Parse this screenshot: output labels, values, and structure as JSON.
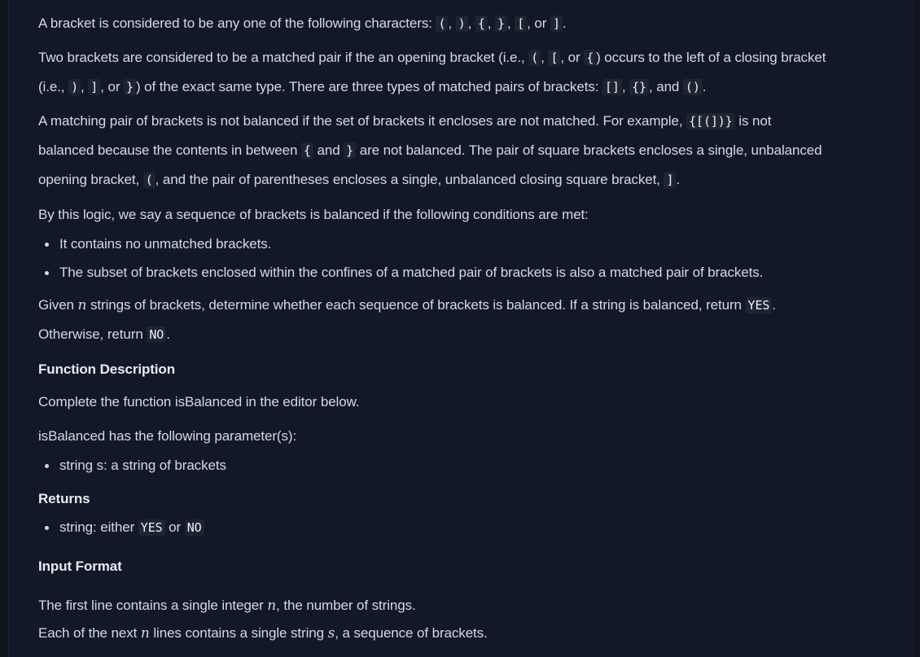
{
  "p1": {
    "a": "A bracket is considered to be any one of the following characters: ",
    "c1": "(",
    "s1": ", ",
    "c2": ")",
    "s2": ", ",
    "c3": "{",
    "s3": ", ",
    "c4": "}",
    "s4": ", ",
    "c5": "[",
    "s5": ", or ",
    "c6": "]",
    "s6": "."
  },
  "p2": {
    "l1a": "Two brackets are considered to be a matched pair if the an opening bracket (i.e., ",
    "c1": "(",
    "s1": ", ",
    "c2": "[",
    "s2": ", or ",
    "c3": "{",
    "l1b": ") occurs to the left of a closing bracket",
    "l2a": "(i.e., ",
    "c4": ")",
    "s4": ", ",
    "c5": "]",
    "s5": ", or ",
    "c6": "}",
    "l2b": ") of the exact same type. There are three types of matched pairs of brackets: ",
    "c7": "[]",
    "s7": ", ",
    "c8": "{}",
    "s8": ", and ",
    "c9": "()",
    "s9": "."
  },
  "p3": {
    "l1a": "A matching pair of brackets is not balanced if the set of brackets it encloses are not matched. For example, ",
    "c1": "{[(])}",
    "l1b": " is not",
    "l2a": "balanced because the contents in between ",
    "c2": "{",
    "l2b": " and ",
    "c3": "}",
    "l2c": " are not balanced. The pair of square brackets encloses a single, unbalanced",
    "l3a": "opening bracket, ",
    "c4": "(",
    "l3b": ", and the pair of parentheses encloses a single, unbalanced closing square bracket, ",
    "c5": "]",
    "l3c": "."
  },
  "p4": "By this logic, we say a sequence of brackets is balanced if the following conditions are met:",
  "conditions": [
    "It contains no unmatched brackets.",
    "The subset of brackets enclosed within the confines of a matched pair of brackets is also a matched pair of brackets."
  ],
  "p5": {
    "l1a": "Given ",
    "n": "n",
    "l1b": " strings of brackets, determine whether each sequence of brackets is balanced. If a string is balanced, return ",
    "yes": "YES",
    "l1c": ".",
    "l2a": "Otherwise, return ",
    "no": "NO",
    "l2b": "."
  },
  "func_desc": {
    "heading": "Function Description",
    "line1": "Complete the function isBalanced in the editor below.",
    "line2": "isBalanced has the following parameter(s):",
    "params": [
      "string s: a string of brackets"
    ]
  },
  "returns": {
    "heading": "Returns",
    "a": "string: either ",
    "yes": "YES",
    "b": " or ",
    "no": "NO"
  },
  "input_format": {
    "heading": "Input Format",
    "l1a": "The first line contains a single integer ",
    "n": "n",
    "l1b": ", the number of strings.",
    "l2a": "Each of the next ",
    "n2": "n",
    "l2b": " lines contains a single string ",
    "s": "s",
    "l2c": ", a sequence of brackets."
  }
}
